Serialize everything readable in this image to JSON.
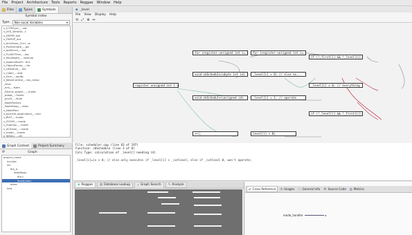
{
  "menubar": [
    "File",
    "Project",
    "Architecture",
    "Tools",
    "Reports",
    "Reggae",
    "Window",
    "Help"
  ],
  "left_top": {
    "tabs": [
      {
        "label": "Files",
        "icon": "folder-icon"
      },
      {
        "label": "Types",
        "icon": "types-icon"
      },
      {
        "label": "Symbols",
        "icon": "symbols-icon"
      }
    ],
    "title": "Symbol index",
    "type_label": "Type:",
    "type_value": "Non-Local Variables",
    "symbols": [
      "s_LCFSSync_...sat",
      "s_XYZ_WriteSt...t",
      "s_DSPRY_kat",
      "s_FWPUP_ant",
      "s_dcUValue_Cncr...w",
      "s_PqrAnimate_...gsl",
      "s_dalStruct_...ast",
      "s_FLASHTime_...lep",
      "s_McaDepth_...interval",
      "s_ApplicationFr...ent",
      "s_ObjectFactor_...ite",
      "s_LReserve_...old",
      "s_Cabin_...stat",
      "s_Dcm_...asdfg",
      "s_WaveControl_...tes_mesa",
      "_level",
      "_nmi_...fsdm",
      "_Device_power_..._mode",
      "_adapt_...frame",
      "_aconf_...fsdm",
      "_NodeFactory",
      "_NodeHeap_...Alloc",
      "s_NodePool",
      "s_particle_application_...mar",
      "s_BVIT_...mode",
      "s_ZOOM_...mode",
      "s_Zoomon_...mode",
      "s_ACSeser_...mode",
      "s_mode_...mode",
      "s_WireLL_...rel",
      "s_wireless_...ave_Control"
    ]
  },
  "left_bottom": {
    "tabs": [
      "Graph Context",
      "Project Summary"
    ],
    "graph_label": "Graph",
    "tree": [
      {
        "indent": 0,
        "label": "project_name"
      },
      {
        "indent": 1,
        "label": "include"
      },
      {
        "indent": 1,
        "label": "src"
      },
      {
        "indent": 2,
        "label": "file_A"
      },
      {
        "indent": 3,
        "label": "dataflows"
      },
      {
        "indent": 4,
        "label": "file.c"
      },
      {
        "indent": 4,
        "label": "level(char)",
        "selected": true
      },
      {
        "indent": 2,
        "label": "other"
      },
      {
        "indent": 1,
        "label": "test"
      }
    ]
  },
  "graph_window": {
    "title": "_level",
    "menu": [
      "File",
      "View",
      "Display",
      "Help"
    ],
    "toolbar": [
      "⟲",
      "⤢",
      "⊕",
      "↔"
    ],
    "nodes": [
      {
        "id": "n1",
        "label": "for (register unsigned int i=..."
      },
      {
        "id": "n2",
        "label": "for (register unsigned int i=..."
      },
      {
        "id": "n3",
        "label": "if (!_first[i] && !_level[i])"
      },
      {
        "id": "n4",
        "label": "void cbSchedule(ubyte int id)"
      },
      {
        "id": "n5",
        "label": "_level[i] > 0) // else no..."
      },
      {
        "id": "n6",
        "label": "register unsigned int i = 0;"
      },
      {
        "id": "n7",
        "label": "_level[i] = 0; // everything"
      },
      {
        "id": "n8",
        "label": "void cbSchedule(unsigned id)"
      },
      {
        "id": "n9",
        "label": "_level[i] = 1; // operate"
      },
      {
        "id": "n10",
        "label": "if (!_level[i] && !_first[i])"
      },
      {
        "id": "n11",
        "label": "++i;"
      },
      {
        "id": "n12",
        "label": "level[i] < 0)"
      }
    ]
  },
  "code_panel": {
    "lines": [
      "File:      scheduler.cpp   (line 83 of 197)",
      "Function:  cbSchedule     (line 3 of  8)",
      "Calc Type: calculation of _level[] needing (4)",
      "",
      "      _level[i]=(x > 0; // else only executes if _level[i] < _cutlevel; else if _cutlevel 0, won't operate;"
    ]
  },
  "map_panel": {
    "tabs": [
      {
        "label": "Reggae",
        "active": true
      },
      {
        "label": "Database Lookup",
        "active": false
      },
      {
        "label": "Graph Search",
        "active": false
      },
      {
        "label": "Analyze",
        "active": false
      }
    ]
  },
  "right_panel": {
    "tabs": [
      {
        "label": "Cross Reference",
        "active": true
      },
      {
        "label": "Usages",
        "active": false
      },
      {
        "label": "General Info",
        "active": false
      },
      {
        "label": "Source Code",
        "active": false
      },
      {
        "label": "Metrics",
        "active": false
      }
    ],
    "content_label": "mode_handler"
  },
  "colors": {
    "edge_green": "#7cbfa4",
    "edge_red": "#c0394c",
    "edge_gray": "#8a8a8a",
    "map_bg": "#6f6f6f"
  }
}
